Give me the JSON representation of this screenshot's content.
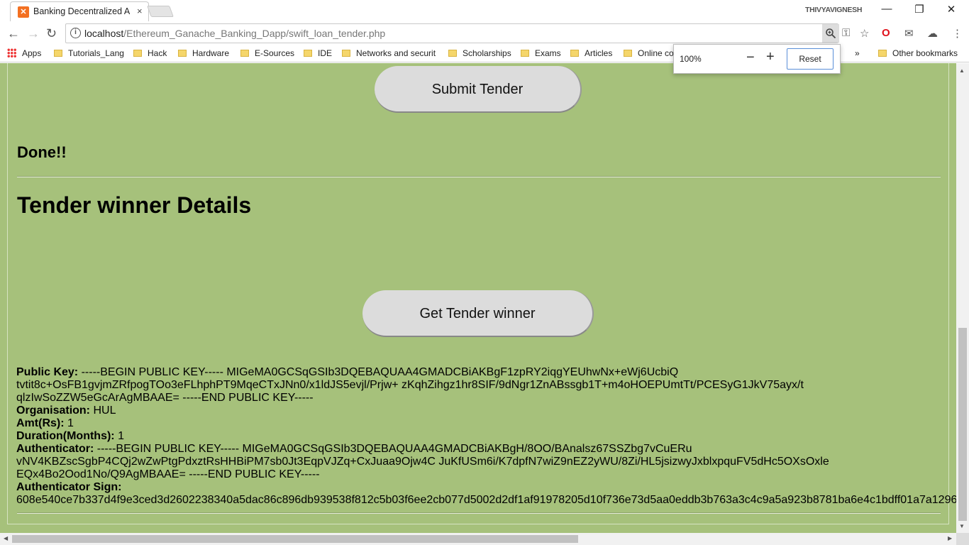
{
  "browser": {
    "tab_title": "Banking Decentralized Ap",
    "tab_close": "×",
    "user_name": "THIVYAVIGNESH",
    "url_host": "localhost",
    "url_path": "/Ethereum_Ganache_Banking_Dapp/swift_loan_tender.php",
    "bookmarks": [
      "Apps",
      "Tutorials_Lang",
      "Hack",
      "Hardware",
      "E-Sources",
      "IDE",
      "Networks and securit",
      "Scholarships",
      "Exams",
      "Articles",
      "Online co"
    ],
    "bookmarks_overflow": "»",
    "other_bookmarks": "Other bookmarks",
    "zoom": {
      "level": "100%",
      "minus": "−",
      "plus": "+",
      "reset": "Reset"
    }
  },
  "page": {
    "submit_button": "Submit Tender",
    "status": "Done!!",
    "heading": "Tender winner Details",
    "get_winner_button": "Get Tender winner",
    "details": {
      "public_key_label": "Public Key:",
      "public_key_line1": " -----BEGIN PUBLIC KEY----- MIGeMA0GCSqGSIb3DQEBAQUAA4GMADCBiAKBgF1zpRY2iqgYEUhwNx+eWj6UcbiQ",
      "public_key_line2": "tvtit8c+OsFB1gvjmZRfpogTOo3eFLhphPT9MqeCTxJNn0/x1ldJS5evjl/Prjw+ zKqhZihgz1hr8SIF/9dNgr1ZnABssgb1T+m4oHOEPUmtTt/PCESyG1JkV75ayx/t",
      "public_key_line3": "qlzIwSoZZW5eGcArAgMBAAE= -----END PUBLIC KEY-----",
      "organisation_label": "Organisation:",
      "organisation_value": " HUL",
      "amount_label": "Amt(Rs):",
      "amount_value": " 1",
      "duration_label": "Duration(Months):",
      "duration_value": " 1",
      "authenticator_label": "Authenticator:",
      "authenticator_line1": " -----BEGIN PUBLIC KEY----- MIGeMA0GCSqGSIb3DQEBAQUAA4GMADCBiAKBgH/8OO/BAnalsz67SSZbg7vCuERu",
      "authenticator_line2": "vNV4KBZscSgbP4CQj2wZwPtgPdxztRsHHBiPM7sb0Jt3EqpVJZq+CxJuaa9Ojw4C JuKfUSm6i/K7dpfN7wiZ9nEZ2yWU/8Zi/HL5jsizwyJxblxpquFV5dHc5OXsOxle",
      "authenticator_line3": "EQx4Bo2Ood1No/Q9AgMBAAE= -----END PUBLIC KEY-----",
      "sign_label": "Authenticator Sign:",
      "sign_value": "608e540ce7b337d4f9e3ced3d2602238340a5dac86c896db939538f812c5b03f6ee2cb077d5002d2df1af91978205d10f736e73d5aa0eddb3b763a3c4c9a5a923b8781ba6e4c1bdff01a7a1296"
    }
  },
  "colors": {
    "page_background": "#a6c17b",
    "button_background": "#dcdcdc"
  },
  "icons": [
    "info-icon",
    "zoom-icon",
    "key-icon",
    "star-icon",
    "opera-icon",
    "extension-icon",
    "menu-icon",
    "back-icon",
    "forward-icon",
    "reload-icon"
  ]
}
